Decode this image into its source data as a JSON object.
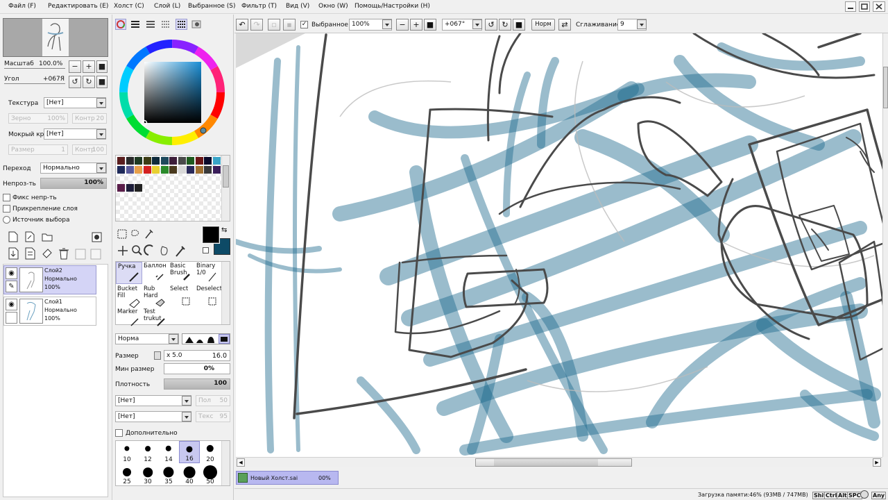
{
  "menu": [
    "Файл (F)",
    "Редактировать (E)",
    "Холст (C)",
    "Слой (L)",
    "Выбранное (S)",
    "Фильтр (T)",
    "Вид (V)",
    "Окно (W)",
    "Помощь/Настройки (H)"
  ],
  "navigator": {
    "zoom_label": "Масштаб",
    "zoom_value": "100.0%",
    "angle_label": "Угол",
    "angle_value": "+067Я"
  },
  "texture": {
    "label": "Текстура",
    "value": "[Нет]",
    "grain_label": "Зерно",
    "grain_value": "100%",
    "contrast_label": "Контр",
    "contrast_value": "20",
    "wet_edge_label": "Мокрый край",
    "wet_edge_value": "[Нет]",
    "size_label": "Размер",
    "size_value": "1",
    "contrast2_label": "Контр",
    "contrast2_value": "100"
  },
  "layer_props": {
    "blend_label": "Переход",
    "blend_value": "Нормально",
    "opacity_label": "Непроз-ть",
    "opacity_value": "100%",
    "opacity_fraction": 1.0,
    "preserve_opacity": "Фикс непр-ть",
    "clip_layer": "Прикрепление слоя",
    "selection_source": "Источник выбора"
  },
  "layers": [
    {
      "name": "Слой2",
      "mode": "Нормально",
      "opacity": "100%",
      "selected": true
    },
    {
      "name": "Слой1",
      "mode": "Нормально",
      "opacity": "100%",
      "selected": false
    }
  ],
  "palette_colors": [
    "#5a1e1e",
    "#2a2a2a",
    "#1e3a22",
    "#3d3d14",
    "#0e2a3a",
    "#1e4a5c",
    "#3d1e3a",
    "#4a4a4a",
    "#1e5a1e",
    "#6a1616",
    "#0a0a2a",
    "#3aa5c8",
    "#1e2a5a",
    "#5a5a9a",
    "#e8a04a",
    "#d42020",
    "#e8d030",
    "#2a8a2a",
    "#4a3a1e",
    "#d8d8d8",
    "#2a2a5a",
    "#a07030",
    "#3a3a3a",
    "#3a1e5a",
    "#5a1e4a",
    "#1e1e3a",
    "#222222"
  ],
  "colors": {
    "primary": "#000000",
    "secondary": "#0d4a66",
    "accent": "#a4a4d8",
    "canvas_stroke": "#1f6a8e"
  },
  "tools": {
    "pen": "Ручка",
    "airbrush": "Баллон",
    "basic_brush": "Basic Brush",
    "binary": "Binary 1/0",
    "bucket": "Bucket Fill",
    "rub": "Rub Hard",
    "select": "Select",
    "deselect": "Deselect",
    "marker": "Marker",
    "test": "Test trukut"
  },
  "brush": {
    "blend_value": "Норма",
    "size_label": "Размер",
    "size_mult": "x 5.0",
    "size_value": "16.0",
    "min_size_label": "Мин размер",
    "min_size_value": "0%",
    "density_label": "Плотность",
    "density_value": "100",
    "shape_value": "[Нет]",
    "shape_strength_label": "Пол",
    "shape_strength_value": "50",
    "texture_value": "[Нет]",
    "texture_strength_label": "Текс",
    "texture_strength_value": "95",
    "advanced_label": "Дополнительно",
    "sizes": [
      "10",
      "12",
      "14",
      "16",
      "20",
      "25",
      "30",
      "35",
      "40",
      "50"
    ],
    "selected_size": "16"
  },
  "toolbar": {
    "selection_label": "Выбранное",
    "zoom_value": "100%",
    "angle_value": "+067°",
    "mode_button": "Норм",
    "stabilizer_label": "Сглаживание",
    "stabilizer_value": "9"
  },
  "document": {
    "tab_name": "Новый Холст.sai",
    "tab_progress": "00%"
  },
  "status": {
    "memory": "Загрузка памяти:46% (93MB / 747MB)",
    "keys": [
      "Shift",
      "Ctrl",
      "Alt",
      "SPC",
      "Any"
    ]
  }
}
